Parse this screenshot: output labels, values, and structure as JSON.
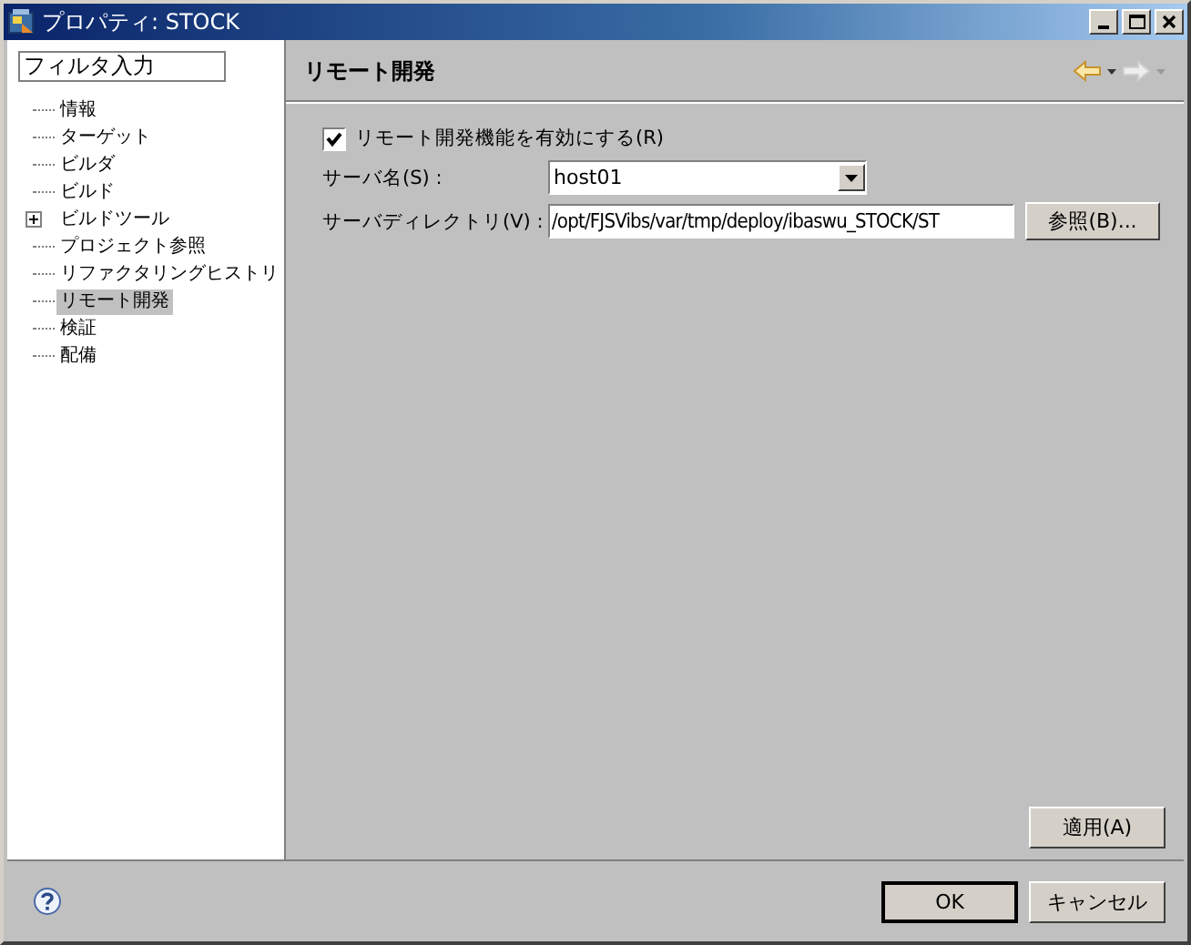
{
  "window": {
    "title": "プロパティ: STOCK"
  },
  "filter": {
    "value": "フィルタ入力"
  },
  "tree": [
    {
      "label": "情報",
      "kind": "leaf",
      "selected": false
    },
    {
      "label": "ターゲット",
      "kind": "leaf",
      "selected": false
    },
    {
      "label": "ビルダ",
      "kind": "leaf",
      "selected": false
    },
    {
      "label": "ビルド",
      "kind": "leaf",
      "selected": false
    },
    {
      "label": "ビルドツール",
      "kind": "collapsed",
      "selected": false
    },
    {
      "label": "プロジェクト参照",
      "kind": "leaf",
      "selected": false
    },
    {
      "label": "リファクタリングヒストリ",
      "kind": "leaf",
      "selected": false
    },
    {
      "label": "リモート開発",
      "kind": "leaf",
      "selected": true
    },
    {
      "label": "検証",
      "kind": "leaf",
      "selected": false
    },
    {
      "label": "配備",
      "kind": "leaf",
      "selected": false
    }
  ],
  "page": {
    "title": "リモート開発",
    "enable": {
      "label": "リモート開発機能を有効にする(R)",
      "checked": true
    },
    "server_name": {
      "label": "サーバ名(S) :",
      "value": "host01"
    },
    "server_dir": {
      "label": "サーバディレクトリ(V) :",
      "value": "/opt/FJSVibs/var/tmp/deploy/ibaswu_STOCK/ST",
      "button": "参照(B)..."
    },
    "apply": "適用(A)"
  },
  "buttons": [
    "OK",
    "キャンセル"
  ]
}
